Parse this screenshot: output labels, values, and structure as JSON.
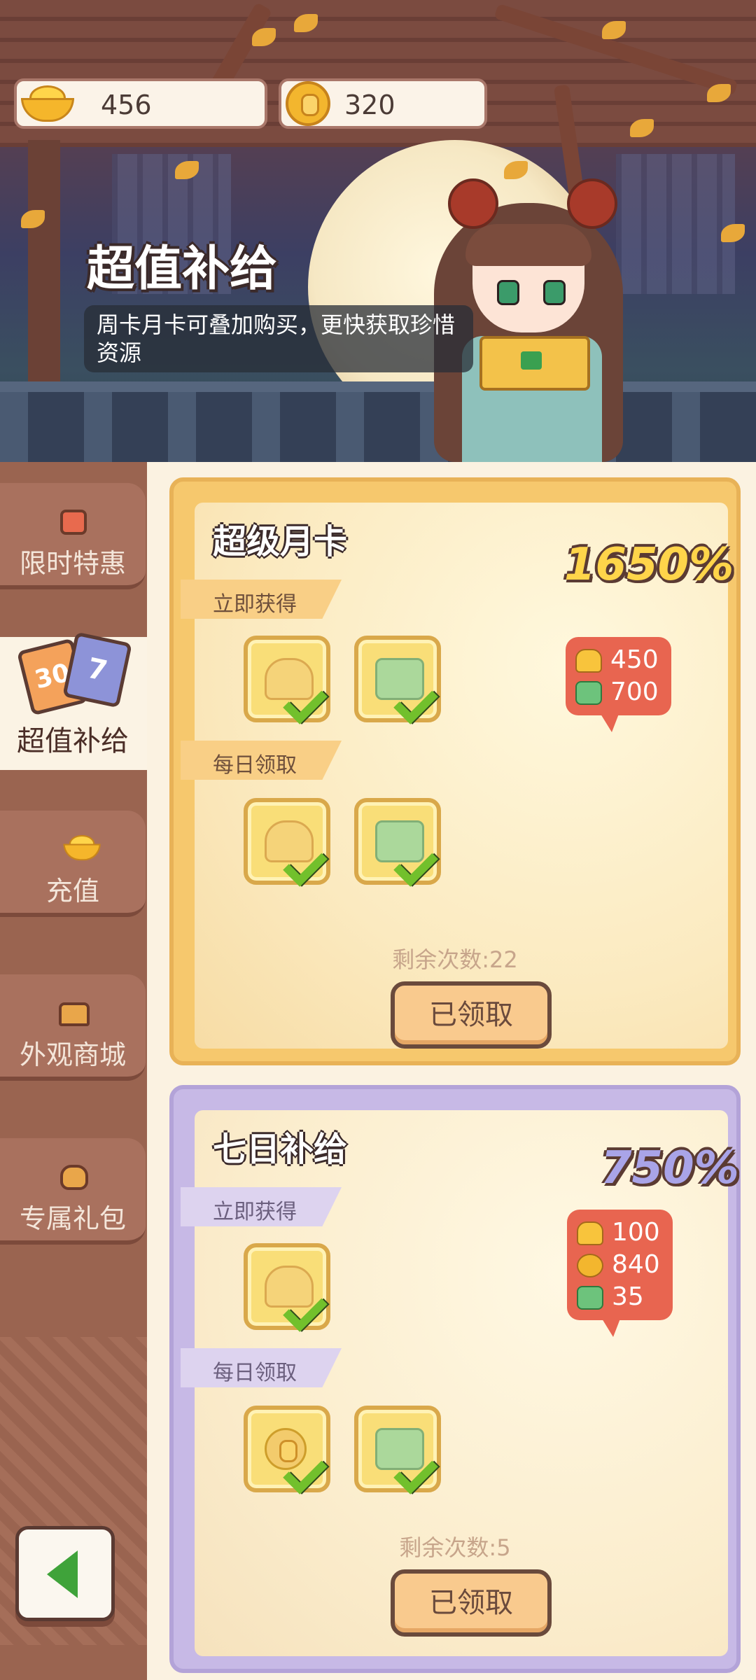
{
  "currency": {
    "gold": "456",
    "coins": "320"
  },
  "banner": {
    "title": "超值补给",
    "subtitle": "周卡月卡可叠加购买，更快获取珍惜资源"
  },
  "sidebar": {
    "items": [
      {
        "label": "限时特惠",
        "icon": "gift-box-icon"
      },
      {
        "label": "超值补给",
        "icon": "cards-30-7-icon",
        "active": true,
        "card_a": "30",
        "card_b": "7"
      },
      {
        "label": "充值",
        "icon": "gold-ingot-icon"
      },
      {
        "label": "外观商城",
        "icon": "chest-icon"
      },
      {
        "label": "专属礼包",
        "icon": "bag-icon"
      }
    ],
    "back_icon": "back-arrow-icon"
  },
  "cards": [
    {
      "title": "超级月卡",
      "percent": "1650%",
      "instant_label": "立即获得",
      "daily_label": "每日领取",
      "rewards": [
        {
          "icon": "gold-ingot-icon",
          "value": "450"
        },
        {
          "icon": "jade-icon",
          "value": "700"
        }
      ],
      "remaining": "剩余次数:22",
      "button": "已领取"
    },
    {
      "title": "七日补给",
      "percent": "750%",
      "instant_label": "立即获得",
      "daily_label": "每日领取",
      "rewards": [
        {
          "icon": "gold-ingot-icon",
          "value": "100"
        },
        {
          "icon": "coin-icon",
          "value": "840"
        },
        {
          "icon": "jade-icon",
          "value": "35"
        }
      ],
      "remaining": "剩余次数:5",
      "button": "已领取"
    }
  ],
  "colors": {
    "sidebar": "#9a6450",
    "gold_card": "#f6c86d",
    "purple_card": "#c7b9e6",
    "bubble": "#e86550",
    "check": "#72c02c"
  }
}
